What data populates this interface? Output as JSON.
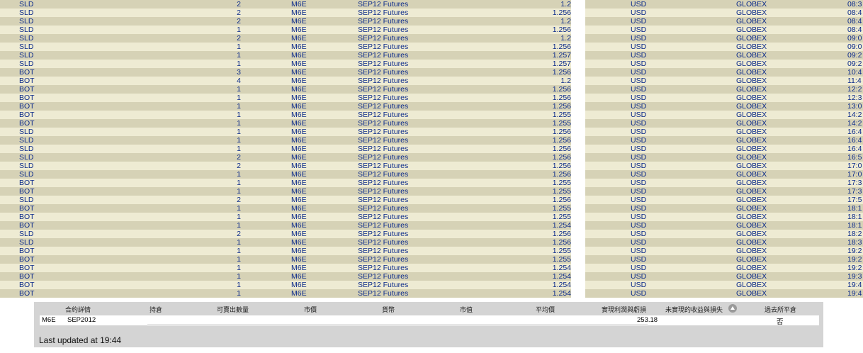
{
  "trades": [
    {
      "action": "SLD",
      "qty": "2",
      "symbol": "M6E",
      "desc": "SEP12 Futures",
      "price": "1.2",
      "currency": "USD",
      "exchange": "GLOBEX",
      "time": "08:3"
    },
    {
      "action": "SLD",
      "qty": "2",
      "symbol": "M6E",
      "desc": "SEP12 Futures",
      "price": "1.256",
      "currency": "USD",
      "exchange": "GLOBEX",
      "time": "08:4"
    },
    {
      "action": "SLD",
      "qty": "2",
      "symbol": "M6E",
      "desc": "SEP12 Futures",
      "price": "1.2",
      "currency": "USD",
      "exchange": "GLOBEX",
      "time": "08:4"
    },
    {
      "action": "SLD",
      "qty": "1",
      "symbol": "M6E",
      "desc": "SEP12 Futures",
      "price": "1.256",
      "currency": "USD",
      "exchange": "GLOBEX",
      "time": "08:4"
    },
    {
      "action": "SLD",
      "qty": "2",
      "symbol": "M6E",
      "desc": "SEP12 Futures",
      "price": "1.2",
      "currency": "USD",
      "exchange": "GLOBEX",
      "time": "09:0"
    },
    {
      "action": "SLD",
      "qty": "1",
      "symbol": "M6E",
      "desc": "SEP12 Futures",
      "price": "1.256",
      "currency": "USD",
      "exchange": "GLOBEX",
      "time": "09:0"
    },
    {
      "action": "SLD",
      "qty": "1",
      "symbol": "M6E",
      "desc": "SEP12 Futures",
      "price": "1.257",
      "currency": "USD",
      "exchange": "GLOBEX",
      "time": "09:2"
    },
    {
      "action": "SLD",
      "qty": "1",
      "symbol": "M6E",
      "desc": "SEP12 Futures",
      "price": "1.257",
      "currency": "USD",
      "exchange": "GLOBEX",
      "time": "09:2"
    },
    {
      "action": "BOT",
      "qty": "3",
      "symbol": "M6E",
      "desc": "SEP12 Futures",
      "price": "1.256",
      "currency": "USD",
      "exchange": "GLOBEX",
      "time": "10:4"
    },
    {
      "action": "BOT",
      "qty": "4",
      "symbol": "M6E",
      "desc": "SEP12 Futures",
      "price": "1.2",
      "currency": "USD",
      "exchange": "GLOBEX",
      "time": "11:4"
    },
    {
      "action": "BOT",
      "qty": "1",
      "symbol": "M6E",
      "desc": "SEP12 Futures",
      "price": "1.256",
      "currency": "USD",
      "exchange": "GLOBEX",
      "time": "12:2"
    },
    {
      "action": "BOT",
      "qty": "1",
      "symbol": "M6E",
      "desc": "SEP12 Futures",
      "price": "1.256",
      "currency": "USD",
      "exchange": "GLOBEX",
      "time": "12:3"
    },
    {
      "action": "BOT",
      "qty": "1",
      "symbol": "M6E",
      "desc": "SEP12 Futures",
      "price": "1.256",
      "currency": "USD",
      "exchange": "GLOBEX",
      "time": "13:0"
    },
    {
      "action": "BOT",
      "qty": "1",
      "symbol": "M6E",
      "desc": "SEP12 Futures",
      "price": "1.255",
      "currency": "USD",
      "exchange": "GLOBEX",
      "time": "14:2"
    },
    {
      "action": "BOT",
      "qty": "1",
      "symbol": "M6E",
      "desc": "SEP12 Futures",
      "price": "1.255",
      "currency": "USD",
      "exchange": "GLOBEX",
      "time": "14:2"
    },
    {
      "action": "SLD",
      "qty": "1",
      "symbol": "M6E",
      "desc": "SEP12 Futures",
      "price": "1.256",
      "currency": "USD",
      "exchange": "GLOBEX",
      "time": "16:4"
    },
    {
      "action": "SLD",
      "qty": "1",
      "symbol": "M6E",
      "desc": "SEP12 Futures",
      "price": "1.256",
      "currency": "USD",
      "exchange": "GLOBEX",
      "time": "16:4"
    },
    {
      "action": "SLD",
      "qty": "1",
      "symbol": "M6E",
      "desc": "SEP12 Futures",
      "price": "1.256",
      "currency": "USD",
      "exchange": "GLOBEX",
      "time": "16:4"
    },
    {
      "action": "SLD",
      "qty": "2",
      "symbol": "M6E",
      "desc": "SEP12 Futures",
      "price": "1.256",
      "currency": "USD",
      "exchange": "GLOBEX",
      "time": "16:5"
    },
    {
      "action": "SLD",
      "qty": "2",
      "symbol": "M6E",
      "desc": "SEP12 Futures",
      "price": "1.256",
      "currency": "USD",
      "exchange": "GLOBEX",
      "time": "17:0"
    },
    {
      "action": "SLD",
      "qty": "1",
      "symbol": "M6E",
      "desc": "SEP12 Futures",
      "price": "1.256",
      "currency": "USD",
      "exchange": "GLOBEX",
      "time": "17:0"
    },
    {
      "action": "BOT",
      "qty": "1",
      "symbol": "M6E",
      "desc": "SEP12 Futures",
      "price": "1.255",
      "currency": "USD",
      "exchange": "GLOBEX",
      "time": "17:3"
    },
    {
      "action": "BOT",
      "qty": "1",
      "symbol": "M6E",
      "desc": "SEP12 Futures",
      "price": "1.255",
      "currency": "USD",
      "exchange": "GLOBEX",
      "time": "17:3"
    },
    {
      "action": "SLD",
      "qty": "2",
      "symbol": "M6E",
      "desc": "SEP12 Futures",
      "price": "1.256",
      "currency": "USD",
      "exchange": "GLOBEX",
      "time": "17:5"
    },
    {
      "action": "BOT",
      "qty": "1",
      "symbol": "M6E",
      "desc": "SEP12 Futures",
      "price": "1.255",
      "currency": "USD",
      "exchange": "GLOBEX",
      "time": "18:1"
    },
    {
      "action": "BOT",
      "qty": "1",
      "symbol": "M6E",
      "desc": "SEP12 Futures",
      "price": "1.255",
      "currency": "USD",
      "exchange": "GLOBEX",
      "time": "18:1"
    },
    {
      "action": "BOT",
      "qty": "1",
      "symbol": "M6E",
      "desc": "SEP12 Futures",
      "price": "1.254",
      "currency": "USD",
      "exchange": "GLOBEX",
      "time": "18:1"
    },
    {
      "action": "SLD",
      "qty": "2",
      "symbol": "M6E",
      "desc": "SEP12 Futures",
      "price": "1.256",
      "currency": "USD",
      "exchange": "GLOBEX",
      "time": "18:2"
    },
    {
      "action": "SLD",
      "qty": "1",
      "symbol": "M6E",
      "desc": "SEP12 Futures",
      "price": "1.256",
      "currency": "USD",
      "exchange": "GLOBEX",
      "time": "18:3"
    },
    {
      "action": "BOT",
      "qty": "1",
      "symbol": "M6E",
      "desc": "SEP12 Futures",
      "price": "1.255",
      "currency": "USD",
      "exchange": "GLOBEX",
      "time": "19:2"
    },
    {
      "action": "BOT",
      "qty": "1",
      "symbol": "M6E",
      "desc": "SEP12 Futures",
      "price": "1.255",
      "currency": "USD",
      "exchange": "GLOBEX",
      "time": "19:2"
    },
    {
      "action": "BOT",
      "qty": "1",
      "symbol": "M6E",
      "desc": "SEP12 Futures",
      "price": "1.254",
      "currency": "USD",
      "exchange": "GLOBEX",
      "time": "19:2"
    },
    {
      "action": "BOT",
      "qty": "1",
      "symbol": "M6E",
      "desc": "SEP12 Futures",
      "price": "1.254",
      "currency": "USD",
      "exchange": "GLOBEX",
      "time": "19:3"
    },
    {
      "action": "BOT",
      "qty": "1",
      "symbol": "M6E",
      "desc": "SEP12 Futures",
      "price": "1.254",
      "currency": "USD",
      "exchange": "GLOBEX",
      "time": "19:4"
    },
    {
      "action": "BOT",
      "qty": "1",
      "symbol": "M6E",
      "desc": "SEP12 Futures",
      "price": "1.254",
      "currency": "USD",
      "exchange": "GLOBEX",
      "time": "19:4"
    }
  ],
  "portfolio": {
    "headers": {
      "contract": "合約詳情",
      "position": "持倉",
      "available": "可賣出數量",
      "market_price": "市價",
      "currency": "貨幣",
      "market_value": "市值",
      "avg_price": "平均價",
      "realized_pnl": "實現利潤與虧損",
      "unrealized_pnl": "未實現的收益與損失",
      "closed": "過去所平倉"
    },
    "row": {
      "symbol": "M6E",
      "expiry": "SEP2012",
      "realized_pnl": "253.18",
      "closed": "否"
    },
    "sort_icon": "arrow-up-circle-icon"
  },
  "status": {
    "last_updated": "Last updated at 19:44"
  }
}
